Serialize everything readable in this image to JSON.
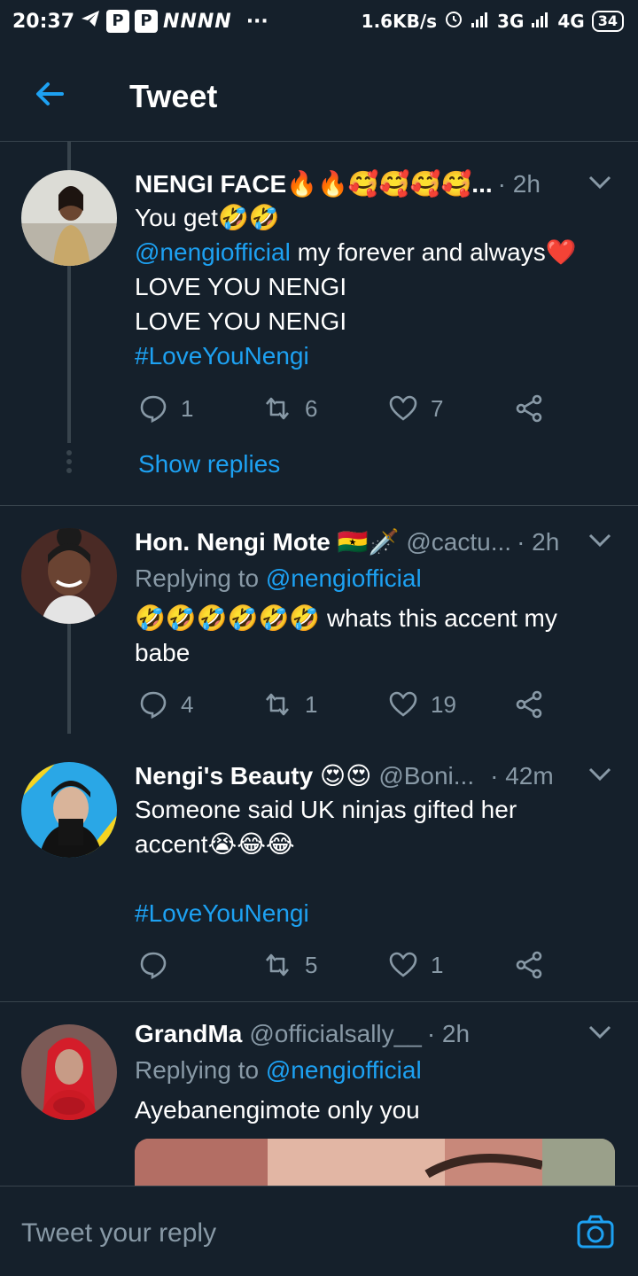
{
  "status_bar": {
    "time": "20:37",
    "app_letters": "NNNN",
    "more": "···",
    "speed": "1.6KB/s",
    "net1": "3G",
    "net2": "4G",
    "battery": "34",
    "p_label": "P"
  },
  "header": {
    "title": "Tweet",
    "back_icon": "arrow-left-icon"
  },
  "tweets": [
    {
      "name": "NENGI FACE🔥🔥🥰🥰🥰🥰...",
      "handle": "",
      "time": "· 2h",
      "lines": [
        "You get🤣🤣",
        "my forever and always❤️",
        "LOVE YOU NENGI",
        "LOVE YOU NENGI",
        "#LoveYouNengi"
      ],
      "mention": "@nengiofficial",
      "reply_count": "1",
      "retweet_count": "6",
      "like_count": "7",
      "show_replies": "Show replies"
    },
    {
      "name": "Hon. Nengi Mote 🇬🇭🗡️",
      "handle": "@cactu...",
      "time": "· 2h",
      "replying_to": "Replying to",
      "mention": "@nengiofficial",
      "line1": "🤣🤣🤣🤣🤣🤣 whats this accent my",
      "line2": "babe",
      "reply_count": "4",
      "retweet_count": "1",
      "like_count": "19"
    },
    {
      "name": "Nengi's Beauty 😍😍",
      "handle": "@Boni...",
      "time": "· 42m",
      "line1": "Someone said UK ninjas gifted her",
      "line2": "accent😭😂😂",
      "hashtag": "#LoveYouNengi",
      "reply_count": "",
      "retweet_count": "5",
      "like_count": "1"
    },
    {
      "name": "GrandMa",
      "handle": "@officialsally__",
      "time": "· 2h",
      "replying_to": "Replying to",
      "mention": "@nengiofficial",
      "line1": "Ayebanengimote only you"
    }
  ],
  "reply_bar": {
    "placeholder": "Tweet your reply",
    "camera_icon": "camera-icon"
  },
  "colors": {
    "background": "#15202b",
    "accent": "#1da1f2",
    "muted": "#8899a6",
    "divider": "#38444d"
  }
}
